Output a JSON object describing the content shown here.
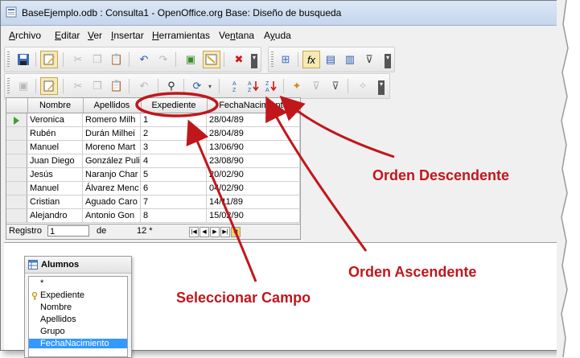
{
  "window": {
    "title": "BaseEjemplo.odb : Consulta1 - OpenOffice.org Base: Diseño de busqueda"
  },
  "menu": [
    {
      "label": "Archivo",
      "accel": "A",
      "rest": "rchivo"
    },
    {
      "label": "Editar",
      "accel": "E",
      "rest": "ditar"
    },
    {
      "label": "Ver",
      "accel": "V",
      "rest": "er"
    },
    {
      "label": "Insertar",
      "accel": "I",
      "rest": "nsertar"
    },
    {
      "label": "Herramientas",
      "accel": "H",
      "rest": "erramientas"
    },
    {
      "label": "Ventana",
      "accel": "n",
      "rest": "tana",
      "prefix": "Ve"
    },
    {
      "label": "Ayuda",
      "accel": "y",
      "rest": "uda",
      "prefix": "A"
    }
  ],
  "grid": {
    "columns": [
      "Nombre",
      "Apellidos",
      "Expediente",
      "FechaNacimiento"
    ],
    "rows": [
      [
        "Veronica",
        "Romero Milh",
        "1",
        "28/04/89"
      ],
      [
        "Rubén",
        "Durán Milhei",
        "2",
        "28/04/89"
      ],
      [
        "Manuel",
        "Moreno Mart",
        "3",
        "13/06/90"
      ],
      [
        "Juan Diego",
        "González Puli",
        "4",
        "23/08/90"
      ],
      [
        "Jesús",
        "Naranjo Char",
        "5",
        "20/02/90"
      ],
      [
        "Manuel",
        "Álvarez Menc",
        "6",
        "04/02/90"
      ],
      [
        "Cristian",
        "Aguado Caro",
        "7",
        "14/11/89"
      ],
      [
        "Alejandro",
        "Antonio Gon",
        "8",
        "15/02/90"
      ]
    ]
  },
  "record_nav": {
    "label": "Registro",
    "current": "1",
    "of_label": "de",
    "total": "12 *"
  },
  "table_box": {
    "title": "Alumnos",
    "fields": [
      "*",
      "Expediente",
      "Nombre",
      "Apellidos",
      "Grupo",
      "FechaNacimiento"
    ]
  },
  "annotations": {
    "descending": "Orden Descendente",
    "ascending": "Orden Ascendente",
    "select_field": "Seleccionar Campo"
  },
  "colors": {
    "annotation": "#c0171c",
    "selection": "#3399ff"
  }
}
